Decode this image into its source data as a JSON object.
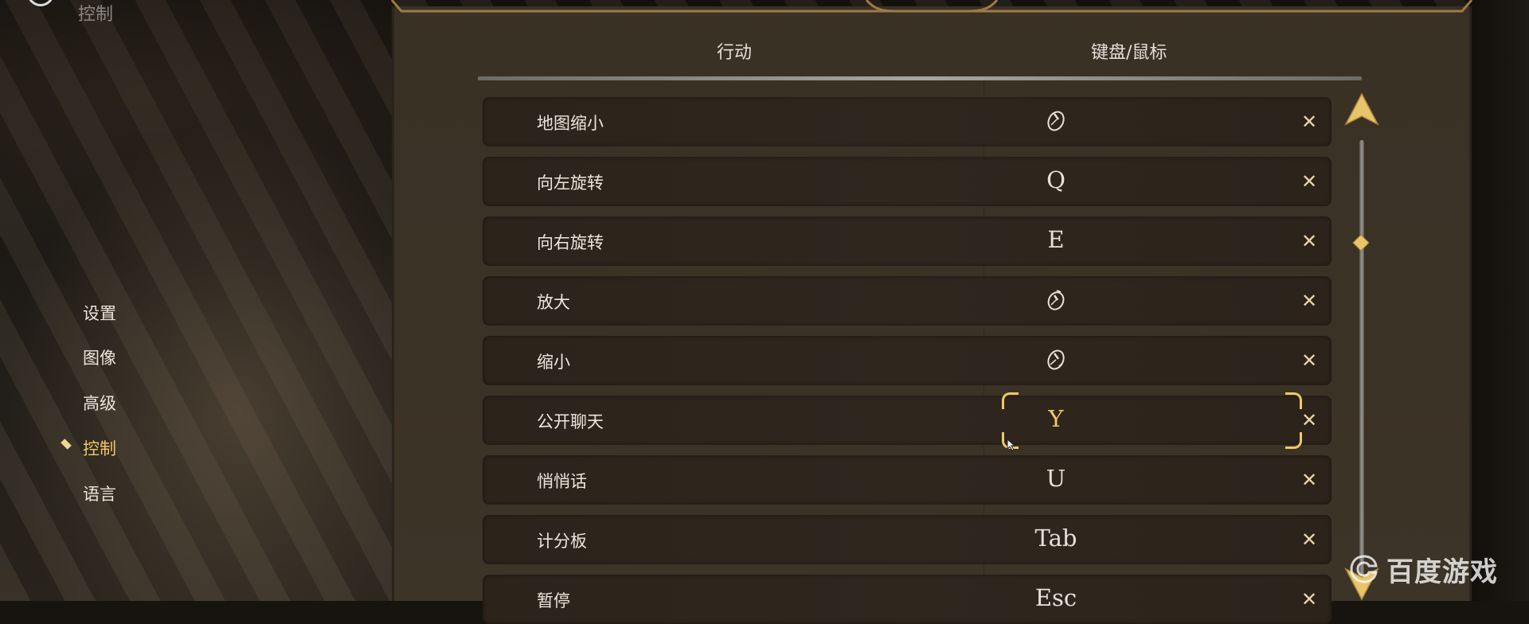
{
  "header": {
    "title": "控制"
  },
  "nav": {
    "items": [
      {
        "label": "设置",
        "active": false
      },
      {
        "label": "图像",
        "active": false
      },
      {
        "label": "高级",
        "active": false
      },
      {
        "label": "控制",
        "active": true
      },
      {
        "label": "语言",
        "active": false
      }
    ]
  },
  "table": {
    "columns": {
      "action": "行动",
      "binding": "键盘/鼠标"
    },
    "rows": [
      {
        "action": "地图缩小",
        "key": "",
        "icon": "mouse-scroll-icon"
      },
      {
        "action": "向左旋转",
        "key": "Q"
      },
      {
        "action": "向右旋转",
        "key": "E"
      },
      {
        "action": "放大",
        "key": "",
        "icon": "mouse-scroll-up-icon"
      },
      {
        "action": "缩小",
        "key": "",
        "icon": "mouse-scroll-down-icon"
      },
      {
        "action": "公开聊天",
        "key": "Y",
        "selected": true
      },
      {
        "action": "悄悄话",
        "key": "U"
      },
      {
        "action": "计分板",
        "key": "Tab"
      },
      {
        "action": "暂停",
        "key": "Esc"
      }
    ],
    "clear_glyph": "✕"
  },
  "watermark": {
    "text": "百度游戏"
  },
  "colors": {
    "accent_gold": "#f0c866",
    "panel_bg": "#3a3125",
    "row_bg": "#2c241b",
    "text_light": "#ece6dc"
  }
}
